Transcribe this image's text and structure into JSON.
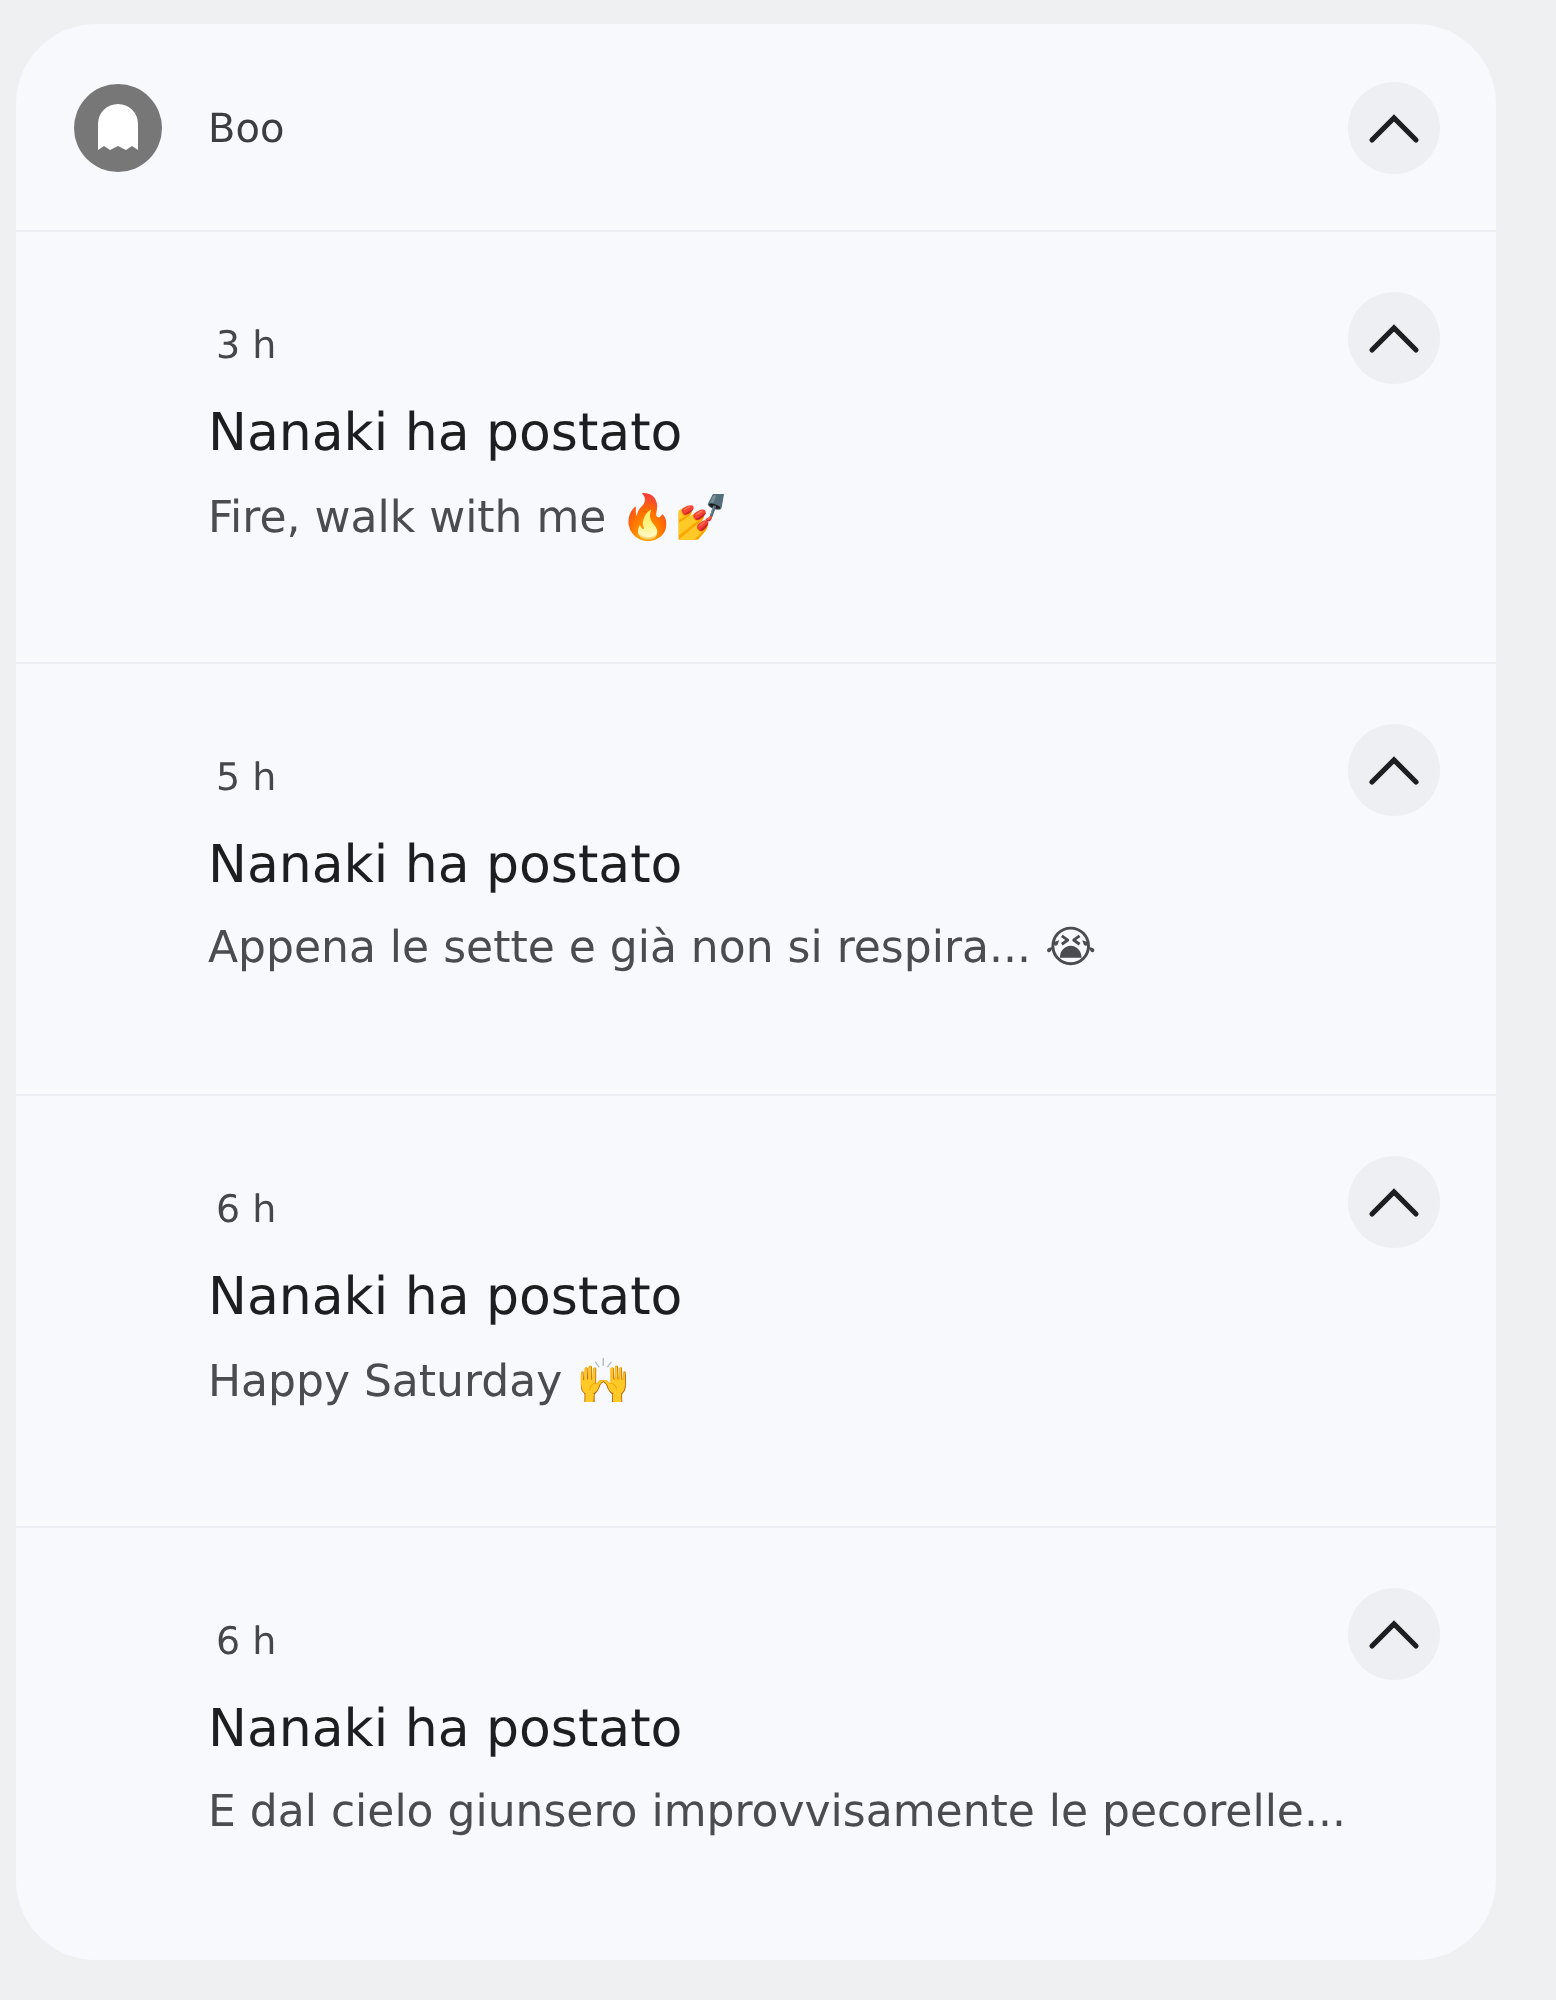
{
  "group": {
    "app_name": "Boo",
    "expanded": true
  },
  "notifications": [
    {
      "time": "3 h",
      "title": "Nanaki ha postato",
      "text": "Fire, walk with me 🔥💅",
      "expanded": true
    },
    {
      "time": "5 h",
      "title": "Nanaki ha postato",
      "text": "Appena le sette e già non si respira... 😭",
      "expanded": true
    },
    {
      "time": "6 h",
      "title": "Nanaki ha postato",
      "text": "Happy Saturday 🙌",
      "expanded": true
    },
    {
      "time": "6 h",
      "title": "Nanaki ha postato",
      "text": "E dal cielo giunsero improvvisamente le pecorelle...",
      "expanded": true
    }
  ]
}
